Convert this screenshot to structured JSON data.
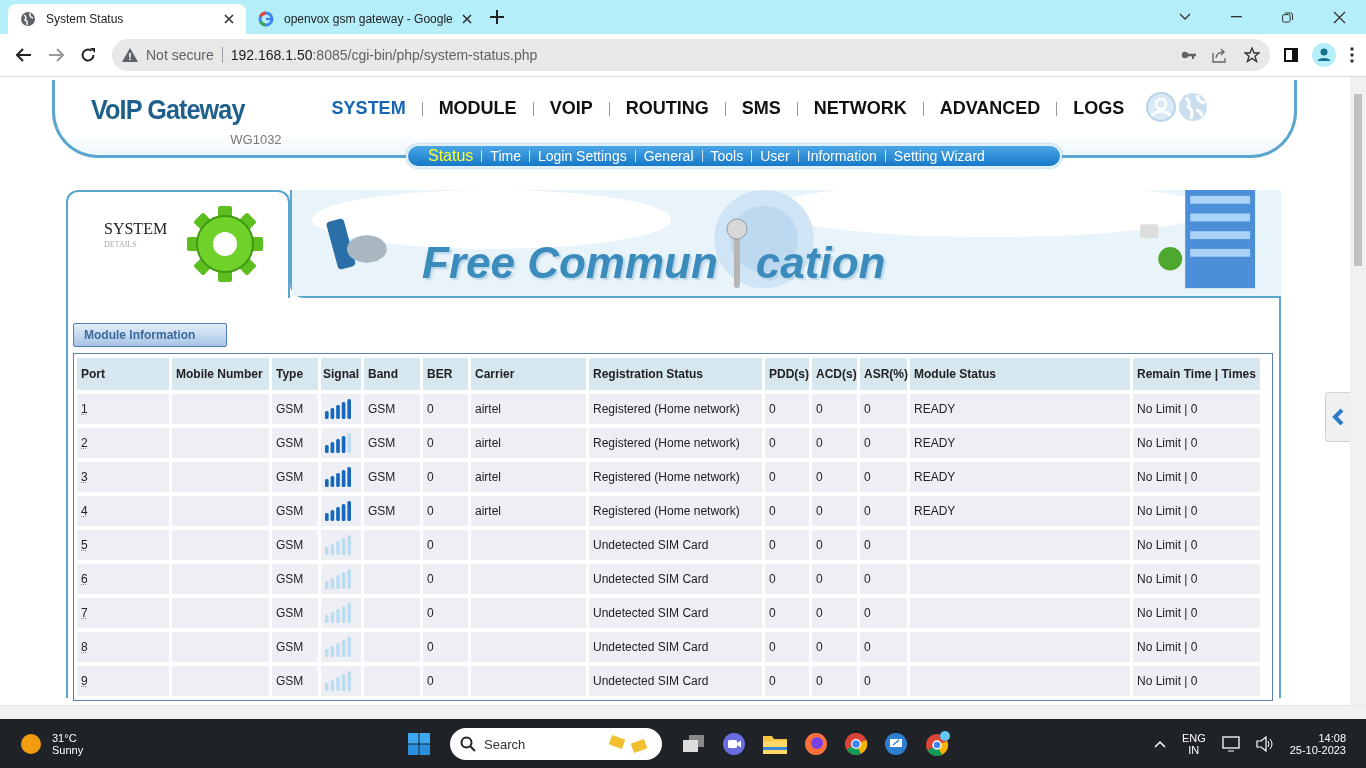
{
  "browser": {
    "tabs": [
      {
        "title": "System Status",
        "selected": true
      },
      {
        "title": "openvox gsm gateway - Google",
        "selected": false
      }
    ],
    "address": {
      "security": "Not secure",
      "host": "192.168.1.50",
      "path": ":8085/cgi-bin/php/system-status.php"
    }
  },
  "header": {
    "logo": "VoIP Gateway",
    "model": "WG1032",
    "nav": [
      {
        "label": "SYSTEM",
        "selected": true
      },
      {
        "label": "MODULE",
        "selected": false
      },
      {
        "label": "VOIP",
        "selected": false
      },
      {
        "label": "ROUTING",
        "selected": false
      },
      {
        "label": "SMS",
        "selected": false
      },
      {
        "label": "NETWORK",
        "selected": false
      },
      {
        "label": "ADVANCED",
        "selected": false
      },
      {
        "label": "LOGS",
        "selected": false
      }
    ],
    "subnav": [
      {
        "label": "Status",
        "selected": true
      },
      {
        "label": "Time",
        "selected": false
      },
      {
        "label": "Login Settings",
        "selected": false
      },
      {
        "label": "General",
        "selected": false
      },
      {
        "label": "Tools",
        "selected": false
      },
      {
        "label": "User",
        "selected": false
      },
      {
        "label": "Information",
        "selected": false
      },
      {
        "label": "Setting Wizard",
        "selected": false
      }
    ]
  },
  "banner": {
    "section_title": "SYSTEM",
    "section_subtitle": "DETAILS",
    "slogan_start": "Free Commun",
    "slogan_end": "cation"
  },
  "module_button": "Module Information",
  "table": {
    "columns": [
      "Port",
      "Mobile Number",
      "Type",
      "Signal",
      "Band",
      "BER",
      "Carrier",
      "Registration Status",
      "PDD(s)",
      "ACD(s)",
      "ASR(%)",
      "Module Status",
      "Remain Time | Times"
    ],
    "rows": [
      {
        "port": "1",
        "type": "GSM",
        "level": 1,
        "band": "GSM",
        "ber": "0",
        "carrier": "airtel",
        "registration": "Registered (Home network)",
        "pdd": "0",
        "acd": "0",
        "asr": "0",
        "module_status": "READY",
        "remain": "No Limit | 0"
      },
      {
        "port": "2",
        "type": "GSM",
        "level": 0.8,
        "band": "GSM",
        "ber": "0",
        "carrier": "airtel",
        "registration": "Registered (Home network)",
        "pdd": "0",
        "acd": "0",
        "asr": "0",
        "module_status": "READY",
        "remain": "No Limit | 0"
      },
      {
        "port": "3",
        "type": "GSM",
        "level": 1,
        "band": "GSM",
        "ber": "0",
        "carrier": "airtel",
        "registration": "Registered (Home network)",
        "pdd": "0",
        "acd": "0",
        "asr": "0",
        "module_status": "READY",
        "remain": "No Limit | 0"
      },
      {
        "port": "4",
        "type": "GSM",
        "level": 1,
        "band": "GSM",
        "ber": "0",
        "carrier": "airtel",
        "registration": "Registered (Home network)",
        "pdd": "0",
        "acd": "0",
        "asr": "0",
        "module_status": "READY",
        "remain": "No Limit | 0"
      },
      {
        "port": "5",
        "type": "GSM",
        "level": 0,
        "ber": "0",
        "registration": "Undetected SIM Card",
        "pdd": "0",
        "acd": "0",
        "asr": "0",
        "remain": "No Limit | 0"
      },
      {
        "port": "6",
        "type": "GSM",
        "level": 0,
        "ber": "0",
        "registration": "Undetected SIM Card",
        "pdd": "0",
        "acd": "0",
        "asr": "0",
        "remain": "No Limit | 0"
      },
      {
        "port": "7",
        "type": "GSM",
        "level": 0,
        "ber": "0",
        "registration": "Undetected SIM Card",
        "pdd": "0",
        "acd": "0",
        "asr": "0",
        "remain": "No Limit | 0"
      },
      {
        "port": "8",
        "type": "GSM",
        "level": 0,
        "ber": "0",
        "registration": "Undetected SIM Card",
        "pdd": "0",
        "acd": "0",
        "asr": "0",
        "remain": "No Limit | 0"
      },
      {
        "port": "9",
        "type": "GSM",
        "level": 0,
        "ber": "0",
        "registration": "Undetected SIM Card",
        "pdd": "0",
        "acd": "0",
        "asr": "0",
        "remain": "No Limit | 0"
      }
    ]
  },
  "taskbar": {
    "temperature": "31°C",
    "condition": "Sunny",
    "search_placeholder": "Search",
    "language": "ENG",
    "region": "IN",
    "time": "14:08",
    "date": "25-10-2023"
  }
}
